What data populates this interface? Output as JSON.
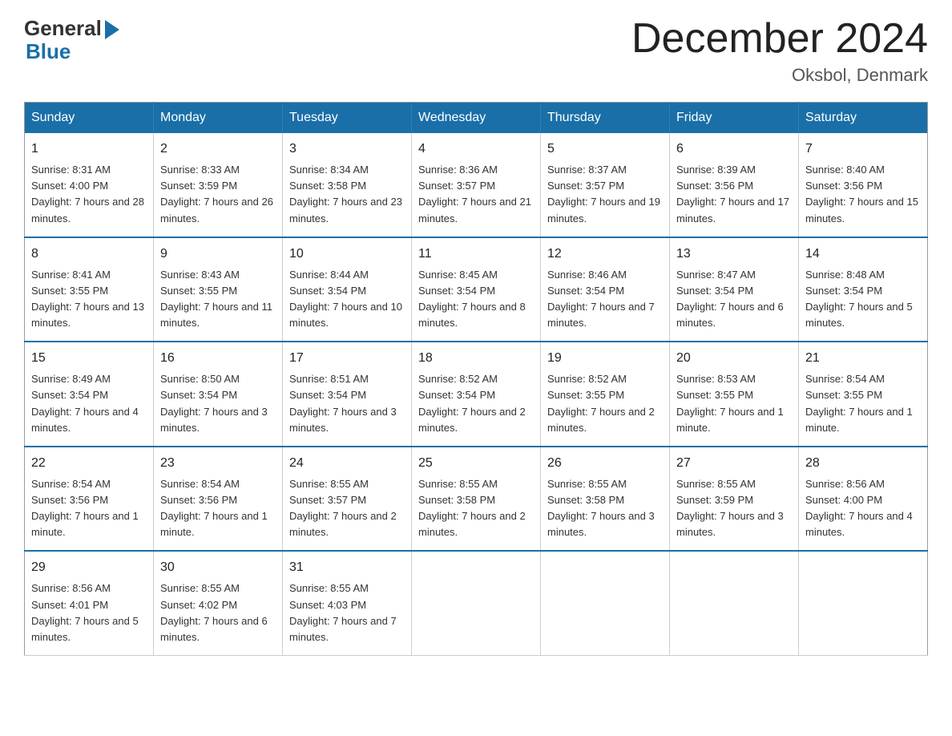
{
  "header": {
    "title": "December 2024",
    "location": "Oksbol, Denmark",
    "logo_general": "General",
    "logo_blue": "Blue"
  },
  "calendar": {
    "days_of_week": [
      "Sunday",
      "Monday",
      "Tuesday",
      "Wednesday",
      "Thursday",
      "Friday",
      "Saturday"
    ],
    "weeks": [
      [
        {
          "day": "1",
          "sunrise": "8:31 AM",
          "sunset": "4:00 PM",
          "daylight": "7 hours and 28 minutes."
        },
        {
          "day": "2",
          "sunrise": "8:33 AM",
          "sunset": "3:59 PM",
          "daylight": "7 hours and 26 minutes."
        },
        {
          "day": "3",
          "sunrise": "8:34 AM",
          "sunset": "3:58 PM",
          "daylight": "7 hours and 23 minutes."
        },
        {
          "day": "4",
          "sunrise": "8:36 AM",
          "sunset": "3:57 PM",
          "daylight": "7 hours and 21 minutes."
        },
        {
          "day": "5",
          "sunrise": "8:37 AM",
          "sunset": "3:57 PM",
          "daylight": "7 hours and 19 minutes."
        },
        {
          "day": "6",
          "sunrise": "8:39 AM",
          "sunset": "3:56 PM",
          "daylight": "7 hours and 17 minutes."
        },
        {
          "day": "7",
          "sunrise": "8:40 AM",
          "sunset": "3:56 PM",
          "daylight": "7 hours and 15 minutes."
        }
      ],
      [
        {
          "day": "8",
          "sunrise": "8:41 AM",
          "sunset": "3:55 PM",
          "daylight": "7 hours and 13 minutes."
        },
        {
          "day": "9",
          "sunrise": "8:43 AM",
          "sunset": "3:55 PM",
          "daylight": "7 hours and 11 minutes."
        },
        {
          "day": "10",
          "sunrise": "8:44 AM",
          "sunset": "3:54 PM",
          "daylight": "7 hours and 10 minutes."
        },
        {
          "day": "11",
          "sunrise": "8:45 AM",
          "sunset": "3:54 PM",
          "daylight": "7 hours and 8 minutes."
        },
        {
          "day": "12",
          "sunrise": "8:46 AM",
          "sunset": "3:54 PM",
          "daylight": "7 hours and 7 minutes."
        },
        {
          "day": "13",
          "sunrise": "8:47 AM",
          "sunset": "3:54 PM",
          "daylight": "7 hours and 6 minutes."
        },
        {
          "day": "14",
          "sunrise": "8:48 AM",
          "sunset": "3:54 PM",
          "daylight": "7 hours and 5 minutes."
        }
      ],
      [
        {
          "day": "15",
          "sunrise": "8:49 AM",
          "sunset": "3:54 PM",
          "daylight": "7 hours and 4 minutes."
        },
        {
          "day": "16",
          "sunrise": "8:50 AM",
          "sunset": "3:54 PM",
          "daylight": "7 hours and 3 minutes."
        },
        {
          "day": "17",
          "sunrise": "8:51 AM",
          "sunset": "3:54 PM",
          "daylight": "7 hours and 3 minutes."
        },
        {
          "day": "18",
          "sunrise": "8:52 AM",
          "sunset": "3:54 PM",
          "daylight": "7 hours and 2 minutes."
        },
        {
          "day": "19",
          "sunrise": "8:52 AM",
          "sunset": "3:55 PM",
          "daylight": "7 hours and 2 minutes."
        },
        {
          "day": "20",
          "sunrise": "8:53 AM",
          "sunset": "3:55 PM",
          "daylight": "7 hours and 1 minute."
        },
        {
          "day": "21",
          "sunrise": "8:54 AM",
          "sunset": "3:55 PM",
          "daylight": "7 hours and 1 minute."
        }
      ],
      [
        {
          "day": "22",
          "sunrise": "8:54 AM",
          "sunset": "3:56 PM",
          "daylight": "7 hours and 1 minute."
        },
        {
          "day": "23",
          "sunrise": "8:54 AM",
          "sunset": "3:56 PM",
          "daylight": "7 hours and 1 minute."
        },
        {
          "day": "24",
          "sunrise": "8:55 AM",
          "sunset": "3:57 PM",
          "daylight": "7 hours and 2 minutes."
        },
        {
          "day": "25",
          "sunrise": "8:55 AM",
          "sunset": "3:58 PM",
          "daylight": "7 hours and 2 minutes."
        },
        {
          "day": "26",
          "sunrise": "8:55 AM",
          "sunset": "3:58 PM",
          "daylight": "7 hours and 3 minutes."
        },
        {
          "day": "27",
          "sunrise": "8:55 AM",
          "sunset": "3:59 PM",
          "daylight": "7 hours and 3 minutes."
        },
        {
          "day": "28",
          "sunrise": "8:56 AM",
          "sunset": "4:00 PM",
          "daylight": "7 hours and 4 minutes."
        }
      ],
      [
        {
          "day": "29",
          "sunrise": "8:56 AM",
          "sunset": "4:01 PM",
          "daylight": "7 hours and 5 minutes."
        },
        {
          "day": "30",
          "sunrise": "8:55 AM",
          "sunset": "4:02 PM",
          "daylight": "7 hours and 6 minutes."
        },
        {
          "day": "31",
          "sunrise": "8:55 AM",
          "sunset": "4:03 PM",
          "daylight": "7 hours and 7 minutes."
        },
        null,
        null,
        null,
        null
      ]
    ]
  }
}
